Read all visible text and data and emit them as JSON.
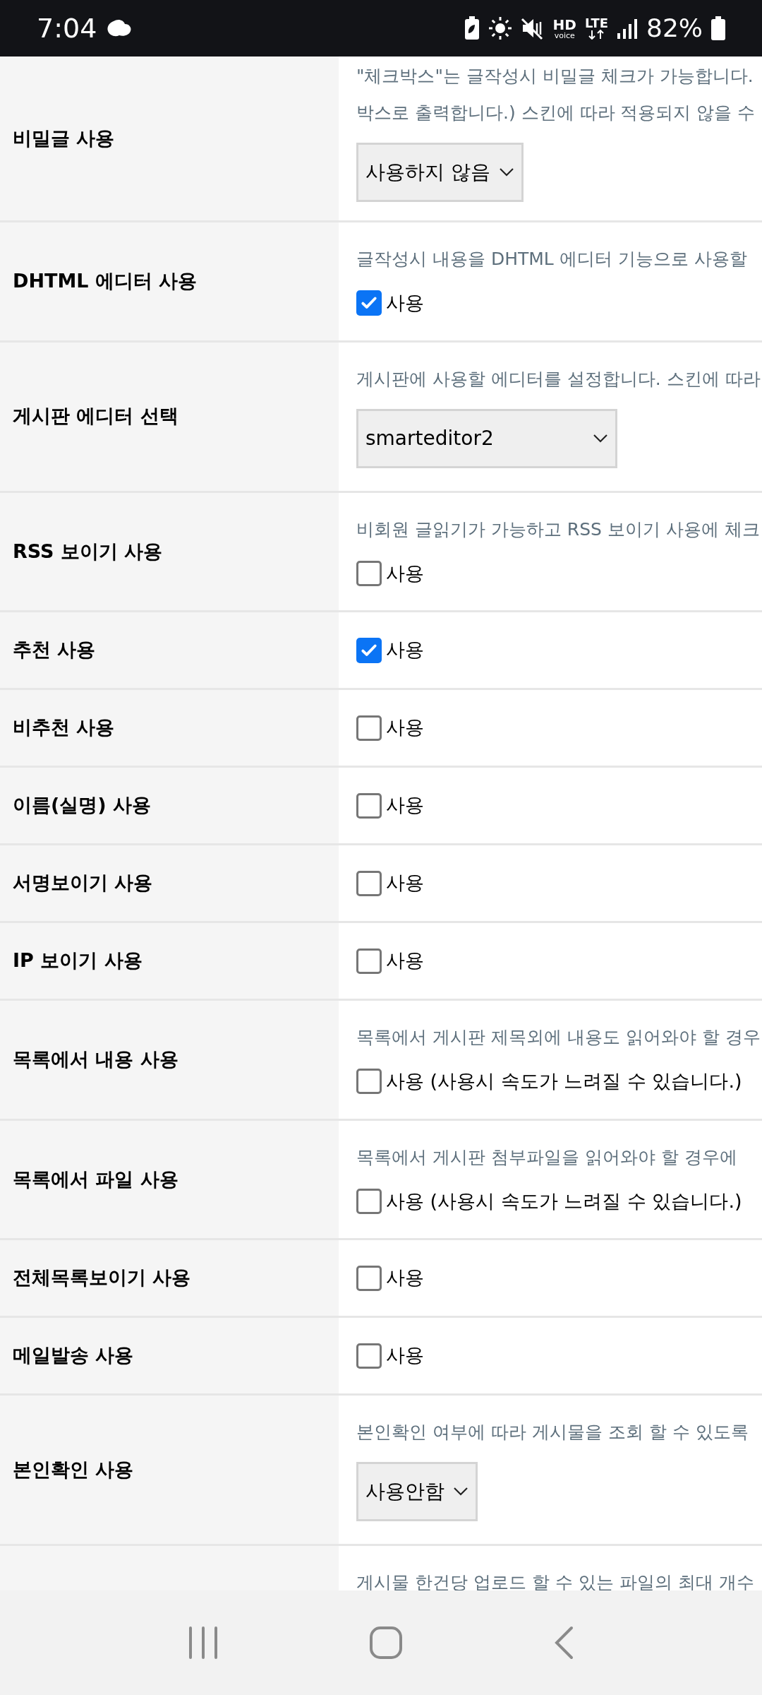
{
  "status_bar": {
    "time": "7:04",
    "hd": "HD",
    "voice": "voice",
    "lte": "LTE",
    "battery": "82%"
  },
  "rows": [
    {
      "label": "비밀글 사용",
      "description": [
        "\"체크박스\"는 글작성시 비밀글 체크가 가능합니다.",
        "박스로 출력합니다.) 스킨에 따라 적용되지 않을 수"
      ],
      "control": {
        "kind": "select",
        "value": "사용하지 않음"
      }
    },
    {
      "label": "DHTML 에디터 사용",
      "description": [
        "글작성시 내용을 DHTML 에디터 기능으로 사용할"
      ],
      "control": {
        "kind": "checkbox",
        "checked": true,
        "text": "사용"
      }
    },
    {
      "label": "게시판 에디터 선택",
      "description": [
        "게시판에 사용할 에디터를 설정합니다. 스킨에 따라"
      ],
      "control": {
        "kind": "select",
        "value": "smarteditor2"
      }
    },
    {
      "label": "RSS 보이기 사용",
      "description": [
        "비회원 글읽기가 가능하고 RSS 보이기 사용에 체크"
      ],
      "control": {
        "kind": "checkbox",
        "checked": false,
        "text": "사용"
      }
    },
    {
      "label": "추천 사용",
      "control": {
        "kind": "checkbox",
        "checked": true,
        "text": "사용"
      }
    },
    {
      "label": "비추천 사용",
      "control": {
        "kind": "checkbox",
        "checked": false,
        "text": "사용"
      }
    },
    {
      "label": "이름(실명) 사용",
      "control": {
        "kind": "checkbox",
        "checked": false,
        "text": "사용"
      }
    },
    {
      "label": "서명보이기 사용",
      "control": {
        "kind": "checkbox",
        "checked": false,
        "text": "사용"
      }
    },
    {
      "label": "IP 보이기 사용",
      "control": {
        "kind": "checkbox",
        "checked": false,
        "text": "사용"
      }
    },
    {
      "label": "목록에서 내용 사용",
      "description": [
        "목록에서 게시판 제목외에 내용도 읽어와야 할 경우"
      ],
      "control": {
        "kind": "checkbox",
        "checked": false,
        "text": "사용 (사용시 속도가 느려질 수 있습니다.)"
      }
    },
    {
      "label": "목록에서 파일 사용",
      "description": [
        "목록에서 게시판 첨부파일을 읽어와야 할 경우에"
      ],
      "control": {
        "kind": "checkbox",
        "checked": false,
        "text": "사용 (사용시 속도가 느려질 수 있습니다.)"
      }
    },
    {
      "label": "전체목록보이기 사용",
      "control": {
        "kind": "checkbox",
        "checked": false,
        "text": "사용"
      }
    },
    {
      "label": "메일발송 사용",
      "control": {
        "kind": "checkbox",
        "checked": false,
        "text": "사용"
      }
    },
    {
      "label": "본인확인 사용",
      "description": [
        "본인확인 여부에 따라 게시물을 조회 할 수 있도록"
      ],
      "control": {
        "kind": "select",
        "value": "사용안함"
      }
    },
    {
      "description": [
        "게시물 한건당 업로드 할 수 있는 파일의 최대 개수"
      ]
    }
  ]
}
